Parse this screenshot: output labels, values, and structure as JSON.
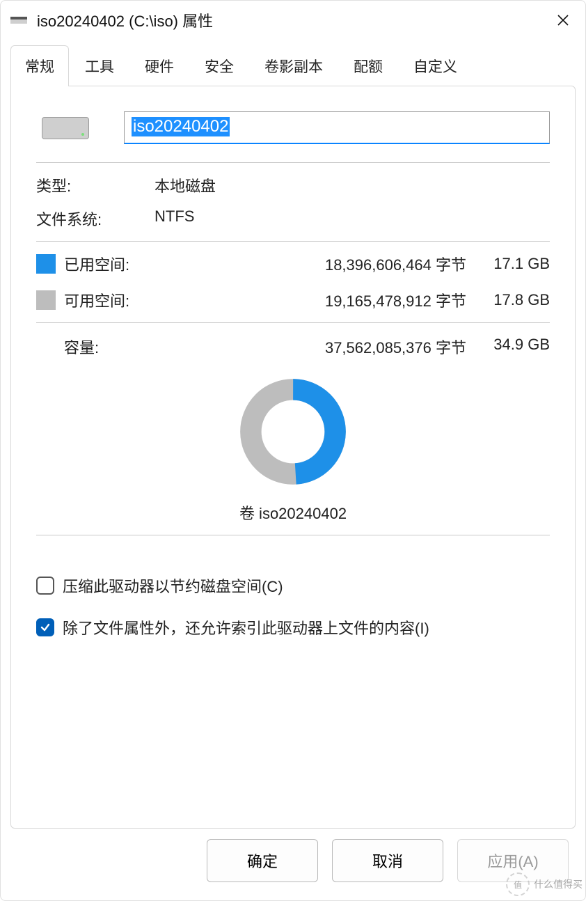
{
  "window": {
    "title": "iso20240402 (C:\\iso) 属性"
  },
  "tabs": [
    "常规",
    "工具",
    "硬件",
    "安全",
    "卷影副本",
    "配额",
    "自定义"
  ],
  "activeTab": 0,
  "general": {
    "name_value": "iso20240402",
    "type_label": "类型:",
    "type_value": "本地磁盘",
    "fs_label": "文件系统:",
    "fs_value": "NTFS",
    "used_label": "已用空间:",
    "used_bytes": "18,396,606,464 字节",
    "used_human": "17.1 GB",
    "free_label": "可用空间:",
    "free_bytes": "19,165,478,912 字节",
    "free_human": "17.8 GB",
    "cap_label": "容量:",
    "cap_bytes": "37,562,085,376 字节",
    "cap_human": "34.9 GB",
    "volume_label": "卷 iso20240402",
    "compress_label": "压缩此驱动器以节约磁盘空间(C)",
    "index_label": "除了文件属性外，还允许索引此驱动器上文件的内容(I)",
    "compress_checked": false,
    "index_checked": true
  },
  "chart_data": {
    "type": "pie",
    "title": "卷 iso20240402",
    "series": [
      {
        "name": "已用空间",
        "value": 18396606464,
        "human": "17.1 GB",
        "color": "#1e90e8"
      },
      {
        "name": "可用空间",
        "value": 19165478912,
        "human": "17.8 GB",
        "color": "#bdbdbd"
      }
    ],
    "total": {
      "name": "容量",
      "value": 37562085376,
      "human": "34.9 GB"
    }
  },
  "buttons": {
    "ok": "确定",
    "cancel": "取消",
    "apply": "应用(A)"
  },
  "watermark": {
    "icon_text": "值",
    "text": "什么值得买"
  }
}
